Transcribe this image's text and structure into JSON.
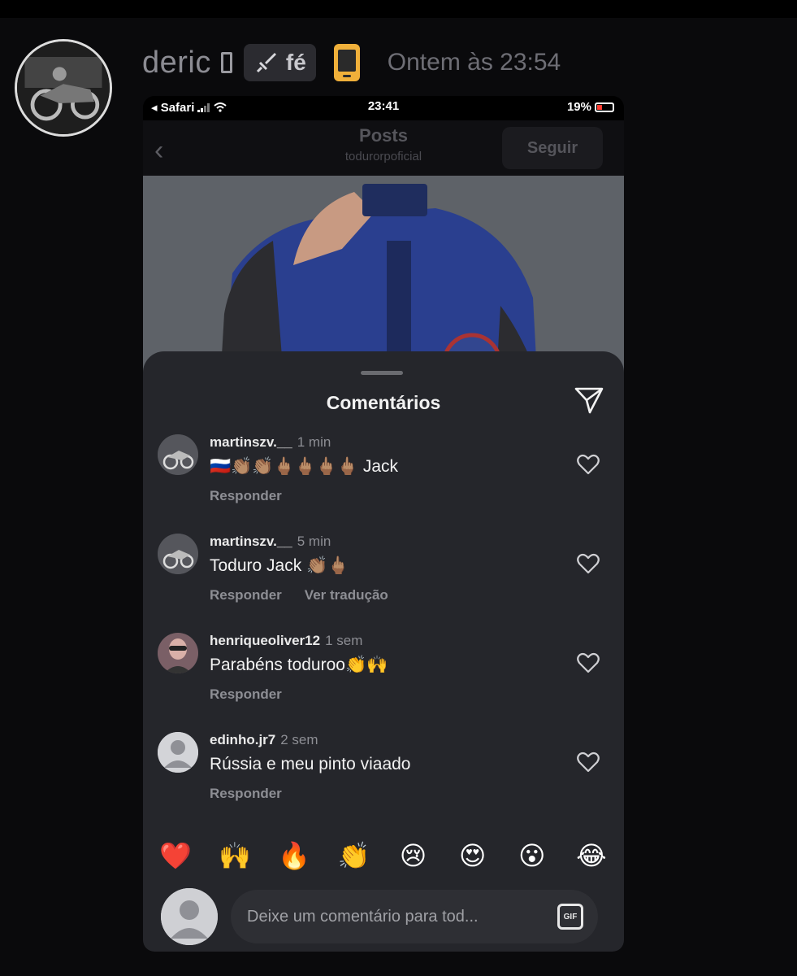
{
  "message": {
    "username": "deric",
    "role_tag": "fé",
    "timestamp": "Ontem às 23:54"
  },
  "status_bar": {
    "back_app": "◂ Safari",
    "time": "23:41",
    "battery": "19%"
  },
  "nav": {
    "back": "‹",
    "title": "Posts",
    "subtitle": "todurorpoficial",
    "follow_label": "Seguir"
  },
  "comments_sheet": {
    "title": "Comentários",
    "comments": [
      {
        "user": "martinszv.__",
        "time": "1 min",
        "text": "🇷🇺👏🏽👏🏽🖕🏽🖕🏽🖕🏽🖕🏽 Jack",
        "reply": "Responder",
        "translate": ""
      },
      {
        "user": "martinszv.__",
        "time": "5 min",
        "text": "Toduro Jack 👏🏽🖕🏽",
        "reply": "Responder",
        "translate": "Ver tradução"
      },
      {
        "user": "henriqueoliver12",
        "time": "1 sem",
        "text": "Parabéns toduroo👏🙌",
        "reply": "Responder",
        "translate": ""
      },
      {
        "user": "edinho.jr7",
        "time": "2 sem",
        "text": "Rússia e meu pinto viaado",
        "reply": "Responder",
        "translate": ""
      }
    ],
    "reactions": [
      "❤️",
      "🙌",
      "🔥",
      "👏",
      "😢",
      "😍",
      "😮",
      "😂"
    ],
    "composer": {
      "placeholder": "Deixe um comentário para tod...",
      "gif_label": "GIF"
    }
  }
}
